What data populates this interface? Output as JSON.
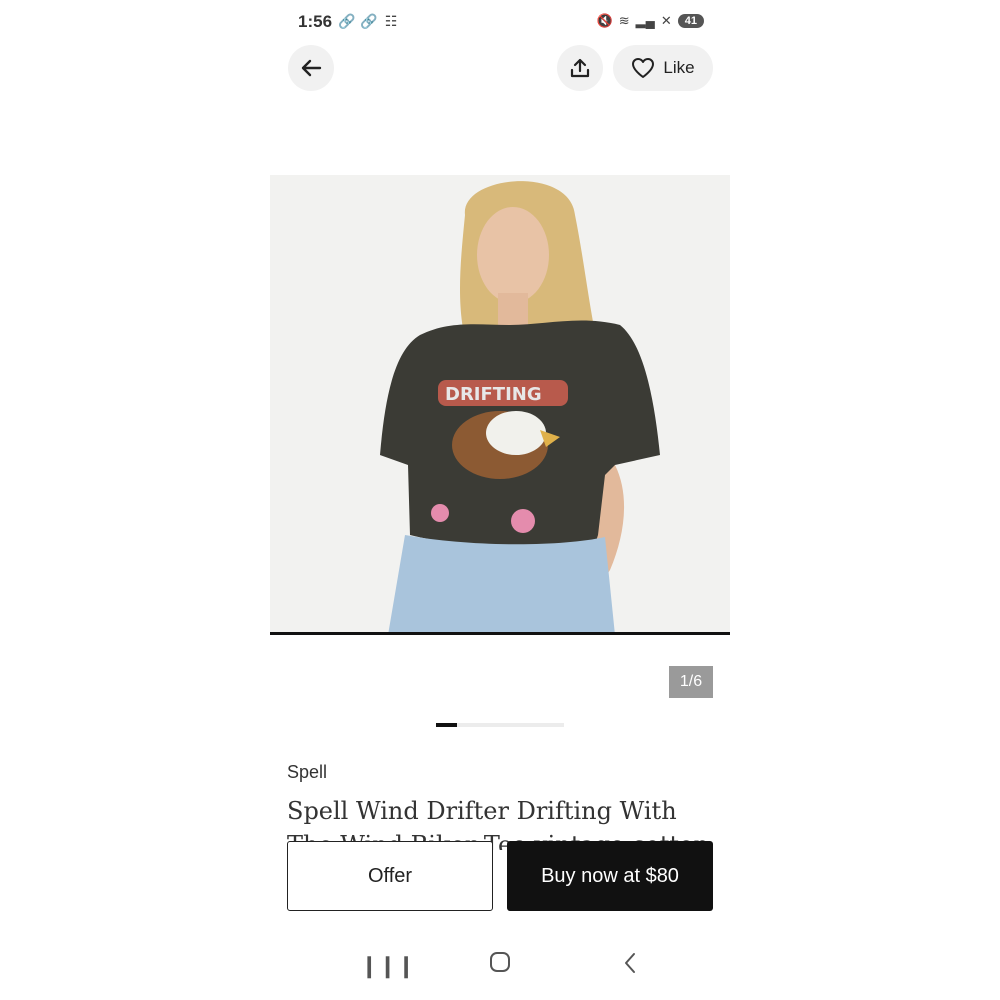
{
  "status_bar": {
    "time": "1:56",
    "left_icons": [
      "link-icon",
      "link-icon",
      "lock-network-icon"
    ],
    "right_icons": [
      "mute-icon",
      "wifi-icon",
      "signal-icon",
      "no-signal-icon"
    ],
    "battery": "41"
  },
  "header": {
    "like_label": "Like"
  },
  "product": {
    "image_counter": "1/6",
    "image_index": 1,
    "image_total": 6,
    "brand": "Spell",
    "title": "Spell Wind Drifter Drifting With The Wind Biker Tee vintage cotton"
  },
  "actions": {
    "offer_label": "Offer",
    "buy_label": "Buy now at $80"
  },
  "colors": {
    "accent": "#111111",
    "button_bg": "#f1f1f1",
    "counter_bg": "#9a9a9a"
  }
}
